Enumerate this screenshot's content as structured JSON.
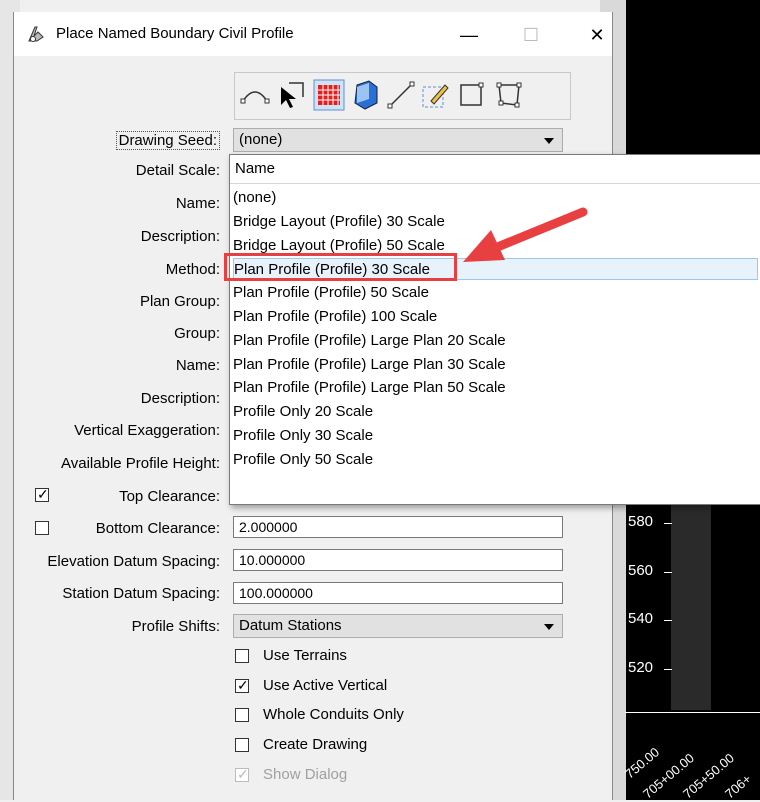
{
  "window": {
    "title": "Place Named Boundary Civil Profile",
    "minimize": "—",
    "maximize": "☐",
    "close": "✕"
  },
  "toolbar": {
    "tools": [
      "curve-boundary-icon",
      "select-pointer-icon",
      "grid-icon",
      "3d-cube-icon",
      "line-icon",
      "edit-boundary-icon",
      "rectangle-icon",
      "polygon-icon"
    ]
  },
  "form": {
    "drawing_seed_label": "Drawing Seed:",
    "drawing_seed_value": "(none)",
    "detail_scale_label": "Detail Scale:",
    "name_label": "Name:",
    "description_label": "Description:",
    "method_label": "Method:",
    "plan_group_label": "Plan Group:",
    "group_label": "Group:",
    "name2_label": "Name:",
    "description2_label": "Description:",
    "vertical_exaggeration_label": "Vertical Exaggeration:",
    "available_profile_height_label": "Available Profile Height:",
    "top_clearance_label": "Top Clearance:",
    "bottom_clearance_label": "Bottom Clearance:",
    "bottom_clearance_value": "2.000000",
    "elevation_datum_spacing_label": "Elevation Datum Spacing:",
    "elevation_datum_spacing_value": "10.000000",
    "station_datum_spacing_label": "Station Datum Spacing:",
    "station_datum_spacing_value": "100.000000",
    "profile_shifts_label": "Profile Shifts:",
    "profile_shifts_value": "Datum Stations",
    "use_terrains": "Use Terrains",
    "use_active_vertical": "Use Active Vertical",
    "whole_conduits_only": "Whole Conduits Only",
    "create_drawing": "Create Drawing",
    "show_dialog": "Show Dialog",
    "top_clearance_checked": true,
    "bottom_clearance_checked": false,
    "use_terrains_checked": false,
    "use_active_vertical_checked": true,
    "whole_conduits_only_checked": false,
    "create_drawing_checked": false,
    "show_dialog_checked": true
  },
  "dropdown": {
    "header": "Name",
    "options": [
      "(none)",
      "Bridge Layout (Profile) 30 Scale",
      "Bridge Layout (Profile) 50 Scale",
      "Plan Profile (Profile) 30 Scale",
      "Plan Profile (Profile) 50 Scale",
      "Plan Profile (Profile) 100 Scale",
      "Plan Profile (Profile) Large Plan 20 Scale",
      "Plan Profile (Profile) Large Plan 30 Scale",
      "Plan Profile (Profile) Large Plan 50 Scale",
      "Profile Only 20 Scale",
      "Profile Only 30 Scale",
      "Profile Only 50 Scale"
    ],
    "selected": "Plan Profile (Profile) 30 Scale"
  },
  "background": {
    "y_labels": [
      "580",
      "560",
      "540",
      "520"
    ],
    "x_labels": [
      "750.00",
      "705+00.00",
      "705+50.00",
      "706+"
    ]
  },
  "colors": {
    "highlight": "#e84040",
    "arrow": "#e84040",
    "selection": "#e8f2fb"
  }
}
